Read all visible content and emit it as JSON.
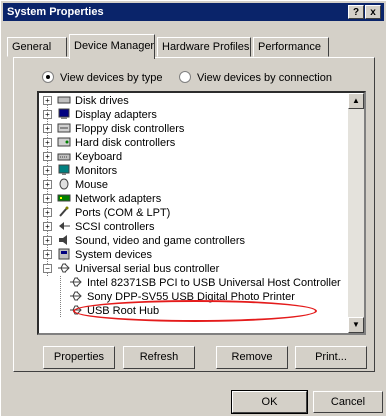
{
  "window": {
    "title": "System Properties",
    "help_btn": "?",
    "close_btn": "x"
  },
  "tabs": [
    {
      "label": "General",
      "active": false
    },
    {
      "label": "Device Manager",
      "active": true
    },
    {
      "label": "Hardware Profiles",
      "active": false
    },
    {
      "label": "Performance",
      "active": false
    }
  ],
  "view": {
    "by_type": {
      "label": "View devices by type",
      "selected": true
    },
    "by_connection": {
      "label": "View devices by connection",
      "selected": false
    }
  },
  "devices": [
    {
      "label": "Disk drives",
      "icon": "disk-drive-icon"
    },
    {
      "label": "Display adapters",
      "icon": "display-adapter-icon"
    },
    {
      "label": "Floppy disk controllers",
      "icon": "floppy-controller-icon"
    },
    {
      "label": "Hard disk controllers",
      "icon": "hard-disk-controller-icon"
    },
    {
      "label": "Keyboard",
      "icon": "keyboard-icon"
    },
    {
      "label": "Monitors",
      "icon": "monitor-icon"
    },
    {
      "label": "Mouse",
      "icon": "mouse-icon"
    },
    {
      "label": "Network adapters",
      "icon": "network-adapter-icon"
    },
    {
      "label": "Ports (COM & LPT)",
      "icon": "port-icon"
    },
    {
      "label": "SCSI controllers",
      "icon": "scsi-icon"
    },
    {
      "label": "Sound, video and game controllers",
      "icon": "sound-icon"
    },
    {
      "label": "System devices",
      "icon": "system-device-icon"
    },
    {
      "label": "Universal serial bus controller",
      "icon": "usb-icon",
      "expanded": true
    }
  ],
  "usb_children": [
    {
      "label": "Intel 82371SB PCI to USB Universal Host Controller",
      "icon": "usb-icon"
    },
    {
      "label": "Sony DPP-SV55 USB Digital Photo Printer",
      "icon": "usb-icon",
      "highlighted": true
    },
    {
      "label": "USB Root Hub",
      "icon": "usb-icon"
    }
  ],
  "buttons": {
    "properties": "Properties",
    "refresh": "Refresh",
    "remove": "Remove",
    "print": "Print..."
  },
  "footer": {
    "ok": "OK",
    "cancel": "Cancel"
  },
  "colors": {
    "titlebar": "#0a246a",
    "face": "#d4d0c8",
    "highlight_ring": "#e41b1b"
  }
}
